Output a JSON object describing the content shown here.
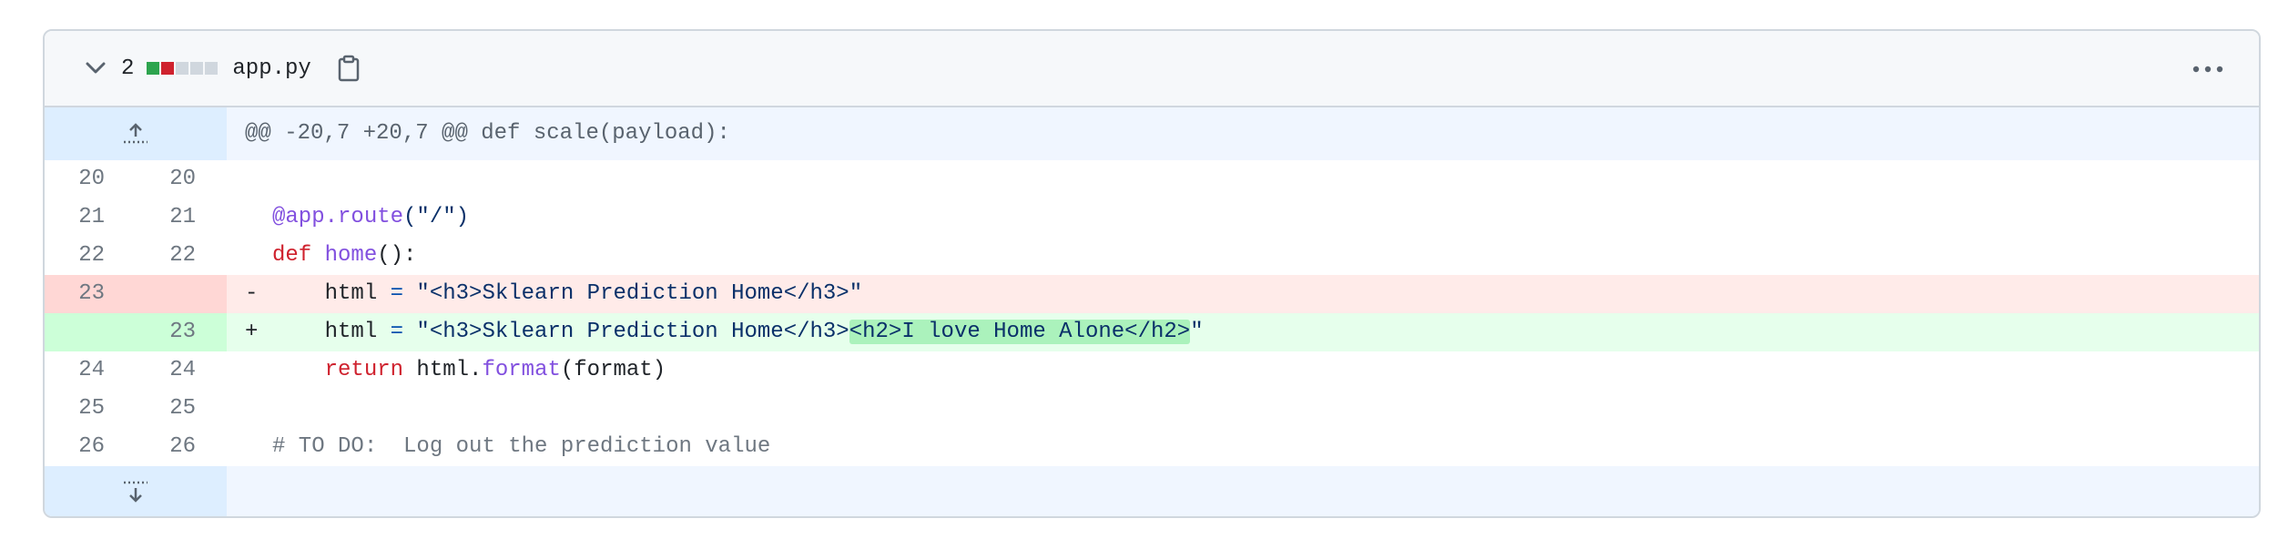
{
  "file": {
    "change_count": "2",
    "name": "app.py",
    "diffstat_colors": [
      "#2da44e",
      "#cf222e",
      "#d0d7de",
      "#d0d7de",
      "#d0d7de"
    ]
  },
  "hunk": {
    "header": "@@ -20,7 +20,7 @@ def scale(payload):"
  },
  "lines": [
    {
      "type": "context",
      "old": "20",
      "new": "20"
    },
    {
      "type": "context",
      "old": "21",
      "new": "21",
      "tokens": [
        {
          "t": "@app.route",
          "c": "k-purple"
        },
        {
          "t": "(\"/\")",
          "c": "k-str"
        }
      ]
    },
    {
      "type": "context",
      "old": "22",
      "new": "22",
      "tokens": [
        {
          "t": "def ",
          "c": "k-red"
        },
        {
          "t": "home",
          "c": "k-purple"
        },
        {
          "t": "():",
          "c": ""
        }
      ]
    },
    {
      "type": "del",
      "old": "23",
      "new": "",
      "marker": "-",
      "tokens": [
        {
          "t": "    html ",
          "c": ""
        },
        {
          "t": "=",
          "c": "k-blue"
        },
        {
          "t": " \"<h3>Sklearn Prediction Home</h3>\"",
          "c": "k-str"
        }
      ]
    },
    {
      "type": "add",
      "old": "",
      "new": "23",
      "marker": "+",
      "tokens": [
        {
          "t": "    html ",
          "c": ""
        },
        {
          "t": "=",
          "c": "k-blue"
        },
        {
          "t": " \"<h3>Sklearn Prediction Home</h3>",
          "c": "k-str"
        },
        {
          "t": "<h2>I love Home Alone</h2>",
          "c": "k-str hl"
        },
        {
          "t": "\"",
          "c": "k-str"
        }
      ]
    },
    {
      "type": "context",
      "old": "24",
      "new": "24",
      "tokens": [
        {
          "t": "    ",
          "c": ""
        },
        {
          "t": "return",
          "c": "k-red"
        },
        {
          "t": " html.",
          "c": ""
        },
        {
          "t": "format",
          "c": "k-purple"
        },
        {
          "t": "(format)",
          "c": ""
        }
      ]
    },
    {
      "type": "context",
      "old": "25",
      "new": "25"
    },
    {
      "type": "context",
      "old": "26",
      "new": "26",
      "tokens": [
        {
          "t": "# TO DO:  Log out the prediction value",
          "c": "k-com"
        }
      ]
    }
  ],
  "icons": {
    "collapse": "chevron-down-icon",
    "copy": "copy-icon",
    "more": "kebab-horizontal-icon",
    "expand_up": "fold-up-icon",
    "expand_down": "fold-down-icon"
  }
}
